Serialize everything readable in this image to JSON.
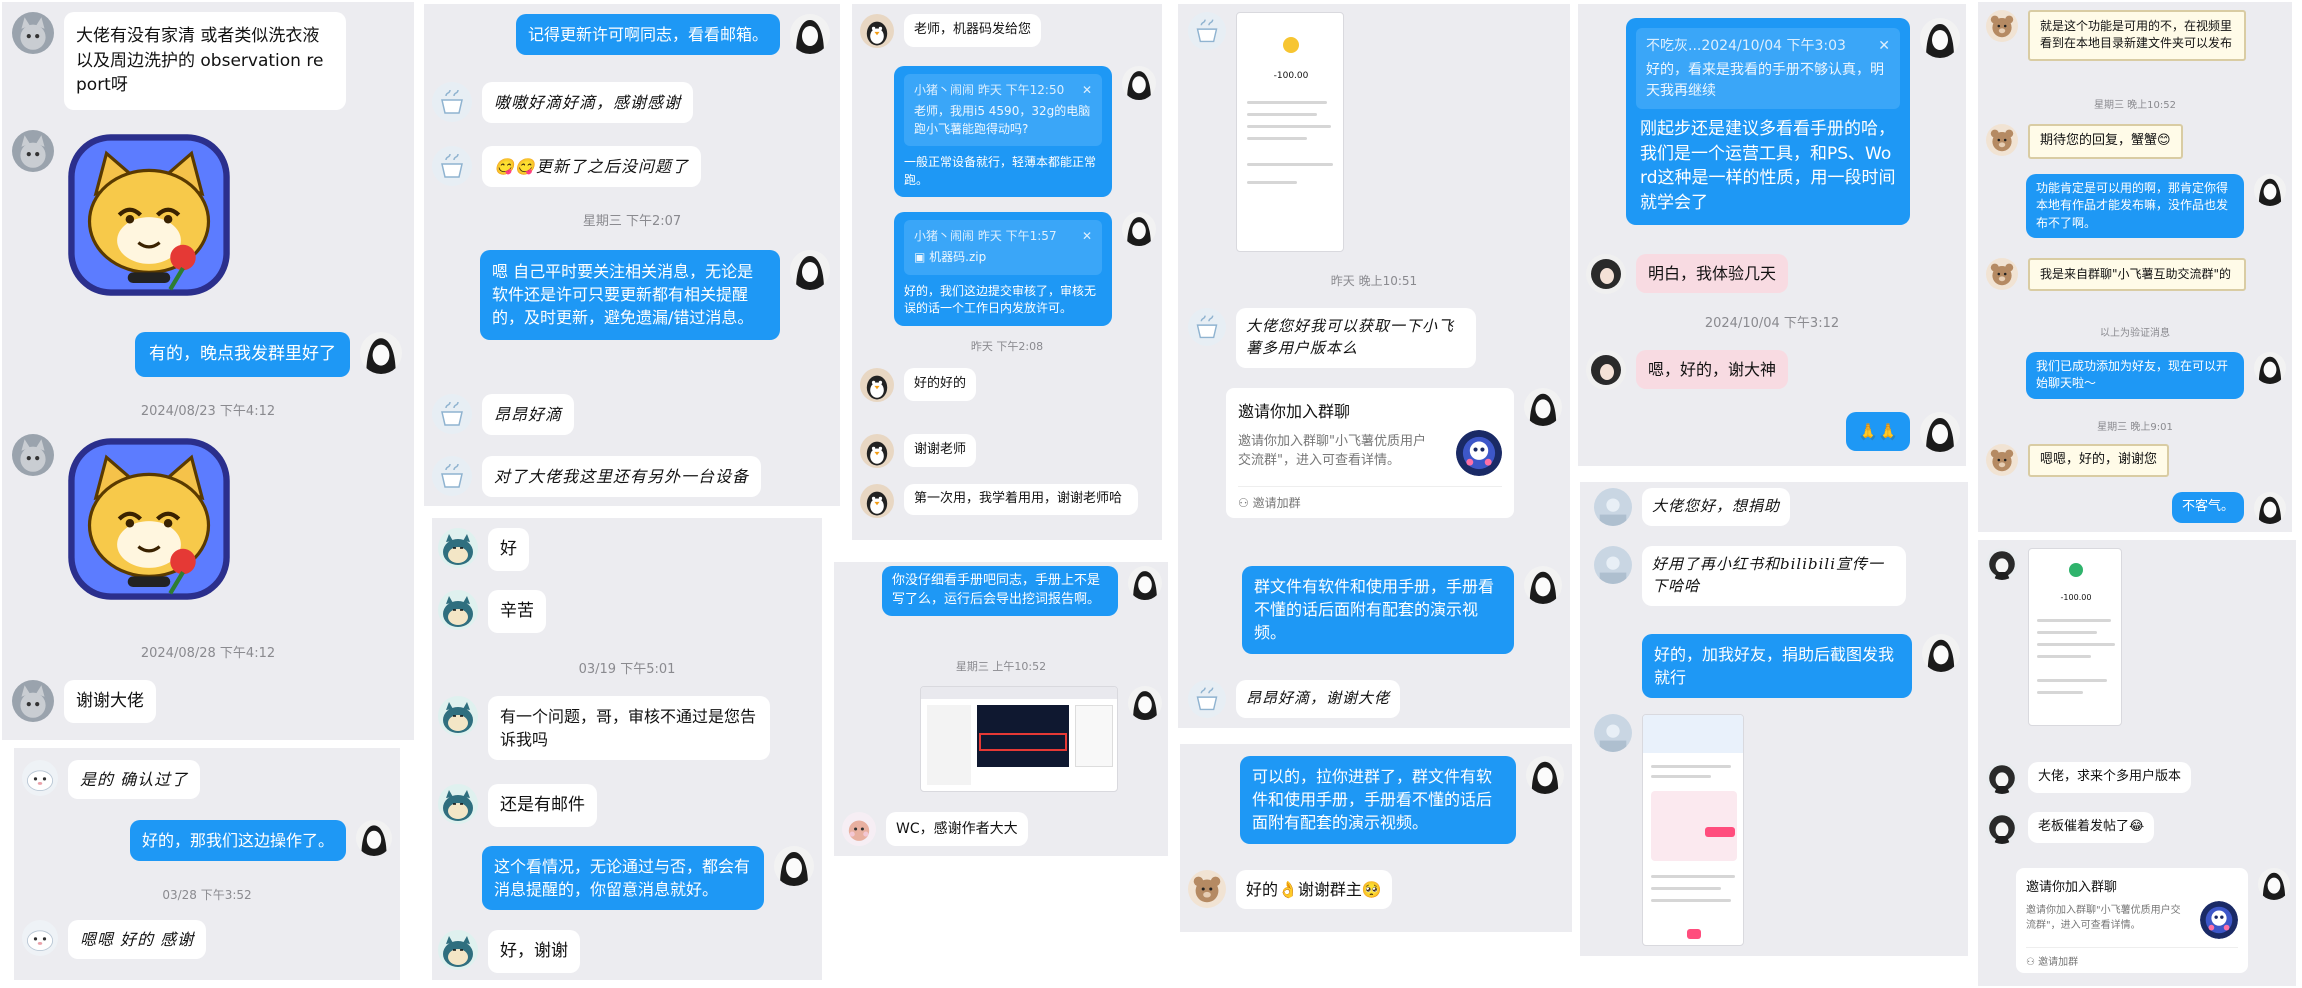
{
  "colors": {
    "panel": "#ececf0",
    "outgoing": "#1e98f5",
    "incoming": "#ffffff",
    "timestamp": "#8a8a8f"
  },
  "icons": {
    "cat_avatar": "gray-cat-avatar-icon",
    "cat_sticker": "cartoon-cat-with-rose-sticker",
    "girl_avatar": "anime-girl-avatar-icon",
    "penguin_avatar": "penguin-avatar-icon",
    "snorlax_avatar": "snorlax-avatar-icon",
    "group_avatar": "group-avatar-icon",
    "zip_file": "zip-file-icon",
    "close": "close-icon"
  },
  "panel1": {
    "msg1": "大佬有没有家清 或者类似洗衣液以及周边洗护的 observation report呀",
    "reply1": "有的，晚点我发群里好了",
    "time1": "2024/08/23 下午4:12",
    "time2": "2024/08/28 下午4:12",
    "msg2": "谢谢大佬"
  },
  "panel2": {
    "msg1": "是的 确认过了",
    "reply1": "好的，那我们这边操作了。",
    "time1": "03/28 下午3:52",
    "msg2": "嗯嗯 好的 感谢"
  },
  "panel3": {
    "out1": "记得更新许可啊同志，看看邮箱。",
    "in1": "嗷嗷好滴好滴，感谢感谢",
    "in2": "😋😋更新了之后没问题了",
    "time1": "星期三 下午2:07",
    "out2": "嗯 自己平时要关注相关消息，无论是软件还是许可只要更新都有相关提醒的，及时更新，避免遗漏/错过消息。",
    "in3": "昂昂好滴",
    "in4": "对了大佬我这里还有另外一台设备"
  },
  "panel4": {
    "in1": "好",
    "in2": "辛苦",
    "time1": "03/19 下午5:01",
    "in3": "有一个问题，哥，审核不通过是您告诉我吗",
    "in4": "还是有邮件",
    "out1": "这个看情况，无论通过与否，都会有消息提醒的，你留意消息就好。",
    "in5": "好，谢谢"
  },
  "panel5": {
    "in1": "老师，机器码发给您",
    "quote1_head": "小猪丶闹闹 昨天 下午12:50",
    "quote1_text": "老师，我用i5 4590，32g的电脑跑小飞薯能跑得动吗?",
    "out1": "一般正常设备就行，轻薄本都能正常跑。",
    "quote2_head": "小猪丶闹闹 昨天 下午1:57",
    "quote2_file": "机器码.zip",
    "out2": "好的，我们这边提交审核了，审核无误的话一个工作日内发放许可。",
    "time1": "昨天 下午2:08",
    "in2": "好的好的",
    "in3": "谢谢老师",
    "in4": "第一次用，我学着用用，谢谢老师哈"
  },
  "panel6": {
    "out1": "你没仔细看手册吧同志，手册上不是写了么，运行后会导出挖词报告啊。",
    "time1": "星期三 上午10:52",
    "in1": "WC，感谢作者大大"
  },
  "panel7": {
    "receipt_amount": "-100.00",
    "time1": "昨天 晚上10:51",
    "in1": "大佬您好我可以获取一下小飞薯多用户版本么",
    "card_title": "邀请你加入群聊",
    "card_body": "邀请你加入群聊\"小飞薯优质用户交流群\"，进入可查看详情。",
    "card_footer": "邀请加群",
    "out1": "群文件有软件和使用手册，手册看不懂的话后面附有配套的演示视频。",
    "in2": "昂昂好滴，谢谢大佬"
  },
  "panel8": {
    "out1": "可以的，拉你进群了，群文件有软件和使用手册，手册看不懂的话后面附有配套的演示视频。",
    "in1": "好的👌谢谢群主🥺"
  },
  "panel9": {
    "quote_head": "不吃灰...2024/10/04 下午3:03",
    "quote_text": "好的，看来是我看的手册不够认真，明天我再继续",
    "out1": "刚起步还是建议多看看手册的哈，我们是一个运营工具，和PS、Word这种是一样的性质，用一段时间就学会了",
    "in1": "明白，我体验几天",
    "time1": "2024/10/04 下午3:12",
    "in2": "嗯，好的，谢大神",
    "out2": "🙏🙏"
  },
  "panel10": {
    "in1": "大佬您好，想捐助",
    "in2": "好用了再小红书和bilibili宣传一下哈哈",
    "out1": "好的，加我好友，捐助后截图发我就行"
  },
  "panel11": {
    "in1": "就是这个功能是可用的不，在视频里看到在本地目录新建文件夹可以发布",
    "time1": "星期三 晚上10:52",
    "in2": "期待您的回复，蟹蟹😊",
    "out1": "功能肯定是可以用的啊，那肯定你得本地有作品才能发布嘛，没作品也发布不了啊。",
    "in3": "我是来自群聊\"小飞薯互助交流群\"的",
    "system1": "以上为验证消息",
    "out2": "我们已成功添加为好友，现在可以开始聊天啦～",
    "time2": "星期三 晚上9:01",
    "in4": "嗯嗯，好的，谢谢您",
    "out3": "不客气。"
  },
  "panel12": {
    "receipt_amount": "-100.00",
    "in1": "大佬，求来个多用户版本",
    "in2": "老板催着发帖了😂",
    "card_title": "邀请你加入群聊",
    "card_body": "邀请你加入群聊\"小飞薯优质用户交流群\"，进入可查看详情。",
    "card_footer": "邀请加群"
  }
}
